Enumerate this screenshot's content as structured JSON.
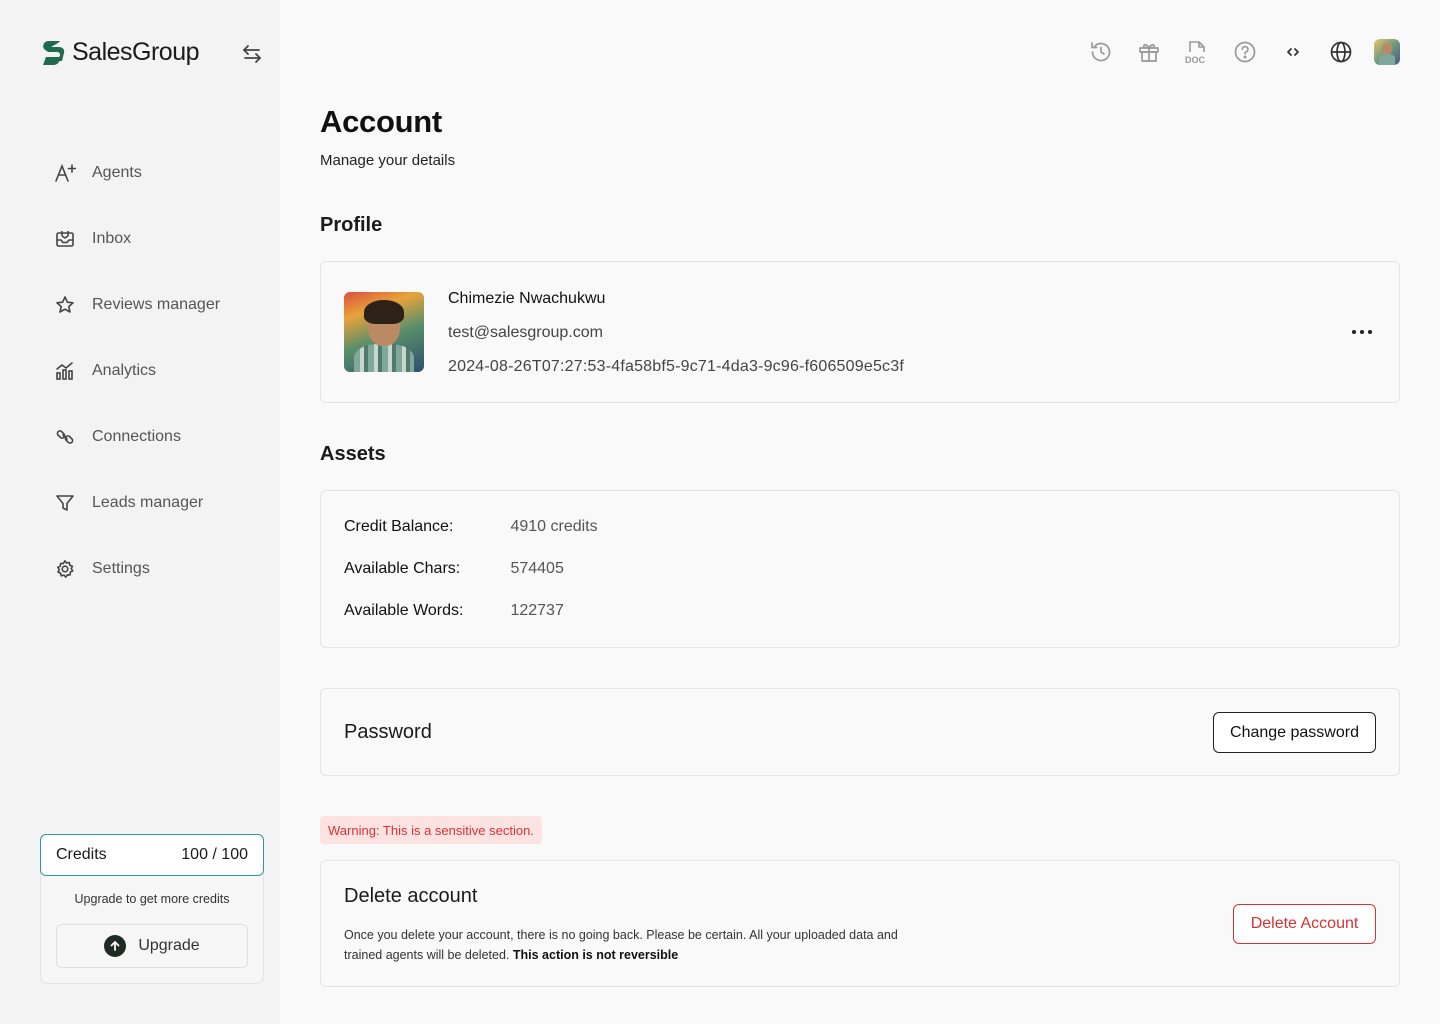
{
  "brand": {
    "name": "SalesGroup",
    "accent": "#2b9c8e",
    "logo_color": "#1e6b4f"
  },
  "sidebar": {
    "items": [
      {
        "label": "Agents",
        "icon": "ai-sparkle-icon"
      },
      {
        "label": "Inbox",
        "icon": "inbox-icon"
      },
      {
        "label": "Reviews manager",
        "icon": "star-icon"
      },
      {
        "label": "Analytics",
        "icon": "bar-chart-icon"
      },
      {
        "label": "Connections",
        "icon": "link-icon"
      },
      {
        "label": "Leads manager",
        "icon": "filter-icon"
      },
      {
        "label": "Settings",
        "icon": "gear-icon"
      }
    ],
    "credits": {
      "label": "Credits",
      "value": "100 / 100",
      "note": "Upgrade to get more credits",
      "upgrade_label": "Upgrade"
    }
  },
  "topbar": {
    "icons": [
      "history-icon",
      "gift-icon",
      "doc-icon",
      "help-icon",
      "code-icon",
      "globe-icon",
      "user-avatar"
    ]
  },
  "page": {
    "title": "Account",
    "subtitle": "Manage your details"
  },
  "profile": {
    "section_title": "Profile",
    "name": "Chimezie Nwachukwu",
    "email": "test@salesgroup.com",
    "id": "2024-08-26T07:27:53-4fa58bf5-9c71-4da3-9c96-f606509e5c3f"
  },
  "assets": {
    "section_title": "Assets",
    "rows": [
      {
        "label": "Credit Balance:",
        "value": "4910 credits"
      },
      {
        "label": "Available Chars:",
        "value": "574405"
      },
      {
        "label": "Available Words:",
        "value": "122737"
      }
    ]
  },
  "password": {
    "title": "Password",
    "button_label": "Change password"
  },
  "danger": {
    "warning": "Warning: This is a sensitive section.",
    "title": "Delete account",
    "description": "Once you delete your account, there is no going back. Please be certain. All your uploaded data and trained agents will be deleted.",
    "emphasis": "This action is not reversible",
    "button_label": "Delete Account",
    "color": "#d63333"
  }
}
